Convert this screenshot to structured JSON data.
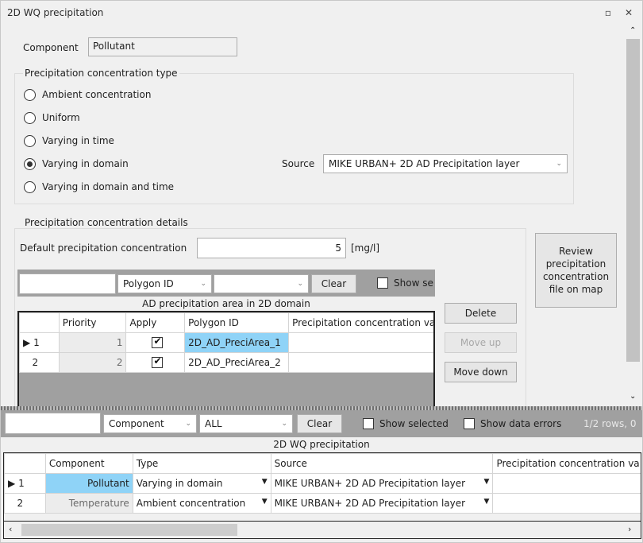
{
  "window": {
    "title": "2D WQ precipitation"
  },
  "component": {
    "label": "Component",
    "value": "Pollutant"
  },
  "conc_type": {
    "legend": "Precipitation concentration type",
    "options": [
      "Ambient concentration",
      "Uniform",
      "Varying in time",
      "Varying in domain",
      "Varying in domain and time"
    ],
    "selected": "Varying in domain",
    "source_label": "Source",
    "source_value": "MIKE URBAN+ 2D AD Precipitation layer"
  },
  "details": {
    "legend": "Precipitation concentration details",
    "default_label": "Default precipitation concentration",
    "default_value": "5",
    "unit": "[mg/l]",
    "review_button": "Review precipitation concentration file on map"
  },
  "area_filter": {
    "search_value": "",
    "field": "Polygon ID",
    "value": "",
    "clear": "Clear",
    "show_selected": "Show se"
  },
  "area_table": {
    "title": "AD precipitation area in 2D domain",
    "headers": [
      "",
      "Priority",
      "Apply",
      "Polygon ID",
      "Precipitation concentration va"
    ],
    "rows": [
      {
        "idx": "1",
        "priority": "1",
        "apply": true,
        "polygon": "2D_AD_PreciArea_1"
      },
      {
        "idx": "2",
        "priority": "2",
        "apply": true,
        "polygon": "2D_AD_PreciArea_2"
      }
    ]
  },
  "side_buttons": {
    "delete": "Delete",
    "move_up": "Move up",
    "move_down": "Move down"
  },
  "bottom_filter": {
    "search_value": "",
    "field": "Component",
    "value": "ALL",
    "clear": "Clear",
    "show_selected": "Show selected",
    "show_errors": "Show data errors",
    "rows_info": "1/2 rows, 0"
  },
  "main_table": {
    "title": "2D WQ precipitation",
    "headers": [
      "",
      "Component",
      "Type",
      "Source",
      "Precipitation concentration va"
    ],
    "rows": [
      {
        "idx": "1",
        "component": "Pollutant",
        "type": "Varying in domain",
        "source": "MIKE URBAN+ 2D AD Precipitation layer"
      },
      {
        "idx": "2",
        "component": "Temperature",
        "type": "Ambient concentration",
        "source": "MIKE URBAN+ 2D AD Precipitation layer"
      }
    ]
  }
}
